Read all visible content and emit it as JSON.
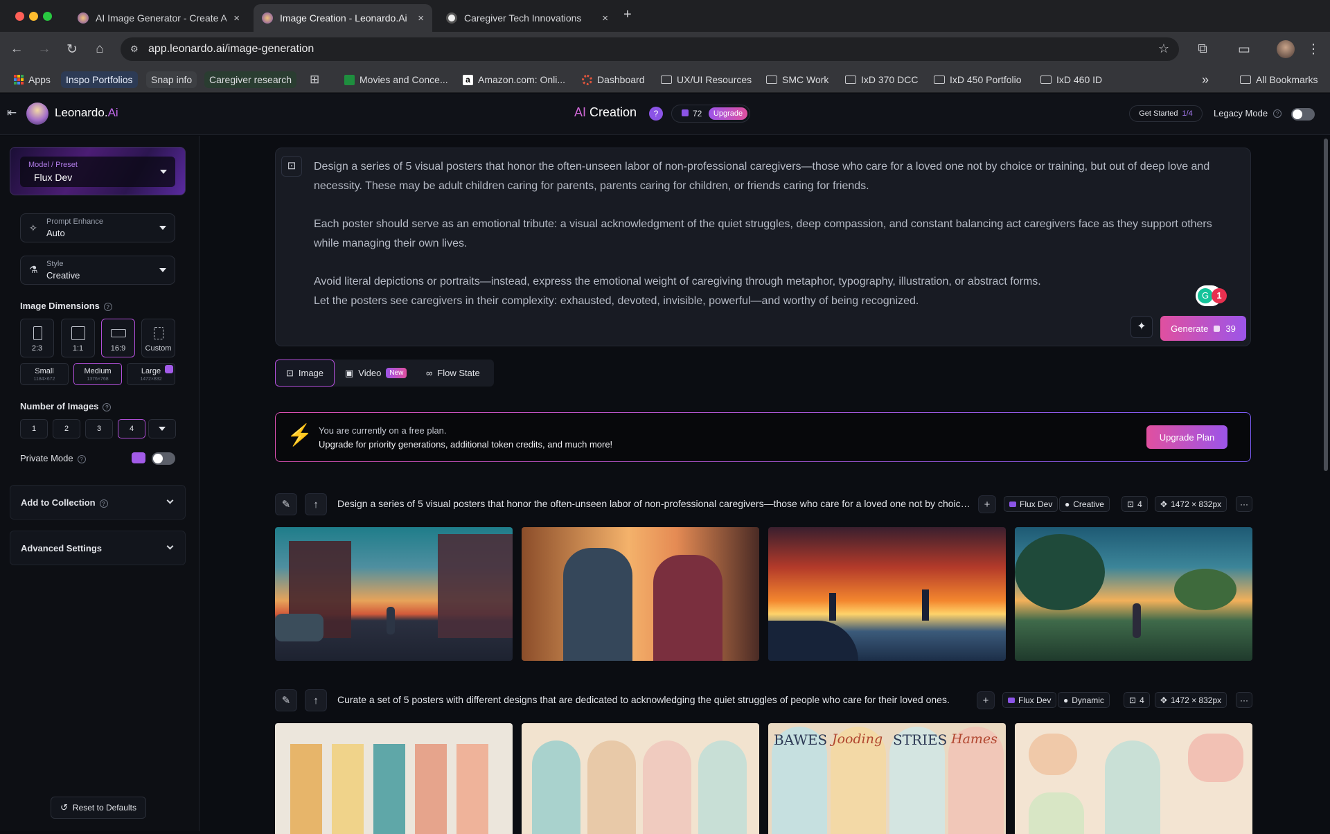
{
  "browser": {
    "tabs": [
      {
        "title": "AI Image Generator - Create A",
        "close": "×"
      },
      {
        "title": "Image Creation - Leonardo.Ai",
        "close": "×"
      },
      {
        "title": "Caregiver Tech Innovations",
        "close": "×"
      }
    ],
    "new_tab": "+",
    "url": "app.leonardo.ai/image-generation",
    "bookmarks": [
      "Apps",
      "Inspo Portfolios",
      "Snap info",
      "Caregiver research",
      "Movies and Conce...",
      "Amazon.com: Onli...",
      "Dashboard",
      "UX/UI Resources",
      "SMC Work",
      "IxD 370 DCC",
      "IxD 450 Portfolio",
      "IxD 460 ID"
    ],
    "overflow": "»",
    "all_bookmarks": "All Bookmarks"
  },
  "app": {
    "brand": "Leonardo.",
    "brand_ai": "Ai",
    "mode_ai": "AI",
    "mode": "Creation",
    "help_badge": "?",
    "tokens": "72",
    "upgrade": "Upgrade",
    "get_started": "Get Started",
    "get_started_progress": "1/4",
    "legacy_mode": "Legacy Mode"
  },
  "sidebar": {
    "model_label": "Model / Preset",
    "model_value": "Flux Dev",
    "enhance_label": "Prompt Enhance",
    "enhance_value": "Auto",
    "style_label": "Style",
    "style_value": "Creative",
    "dimensions_title": "Image Dimensions",
    "ratios": [
      "2:3",
      "1:1",
      "16:9",
      "Custom"
    ],
    "sizes": [
      {
        "name": "Small",
        "px": "1184×672"
      },
      {
        "name": "Medium",
        "px": "1376×768"
      },
      {
        "name": "Large",
        "px": "1472×832"
      }
    ],
    "num_images_title": "Number of Images",
    "num_options": [
      "1",
      "2",
      "3",
      "4"
    ],
    "private_mode": "Private Mode",
    "add_to_collection": "Add to Collection",
    "advanced_settings": "Advanced Settings",
    "reset": "Reset to Defaults"
  },
  "prompt": {
    "p1": "Design a series of 5 visual posters that honor the often-unseen labor of non-professional caregivers—those who care for a loved one not by choice or training, but out of deep love and necessity. These may be adult children caring for parents, parents caring for children, or friends caring for friends.",
    "p2": "Each poster should serve as an emotional tribute: a visual acknowledgment of the quiet struggles, deep compassion, and constant balancing act caregivers face as they support others while managing their own lives.",
    "p3a": "Avoid literal depictions or portraits—instead, express the emotional weight of caregiving through metaphor, typography, illustration, or abstract forms.",
    "p3b": "Let the posters see caregivers in their complexity: exhausted, devoted, invisible, powerful—and worthy of being recognized.",
    "grammar_count": "1",
    "generate": "Generate",
    "generate_cost": "39"
  },
  "mode_tabs": {
    "image": "Image",
    "video": "Video",
    "video_badge": "New",
    "flow": "Flow State"
  },
  "banner": {
    "line1": "You are currently on a free plan.",
    "line2": "Upgrade for priority generations, additional token credits, and much more!",
    "button": "Upgrade Plan"
  },
  "generations": [
    {
      "prompt": "Design a series of 5 visual posters that honor the often-unseen labor of non-professional caregivers—those who care for a loved one not by choice or training, but out of deep love and necessity.",
      "model": "Flux Dev",
      "style": "Creative",
      "count": "4",
      "size": "1472 × 832px",
      "more": "···",
      "plus": "+"
    },
    {
      "prompt": "Curate a set of 5 posters with different designs that are dedicated to acknowledging the quiet struggles of people who care for their loved ones.",
      "model": "Flux Dev",
      "style": "Dynamic",
      "count": "4",
      "size": "1472 × 832px",
      "more": "···",
      "plus": "+"
    }
  ],
  "poster_words": [
    "BAWES",
    "Jooding",
    "STRIES",
    "Hames"
  ],
  "colors": {
    "accent_pink": "#e0509f",
    "accent_purple": "#9c55e9",
    "selected_border": "#b14fd8"
  }
}
